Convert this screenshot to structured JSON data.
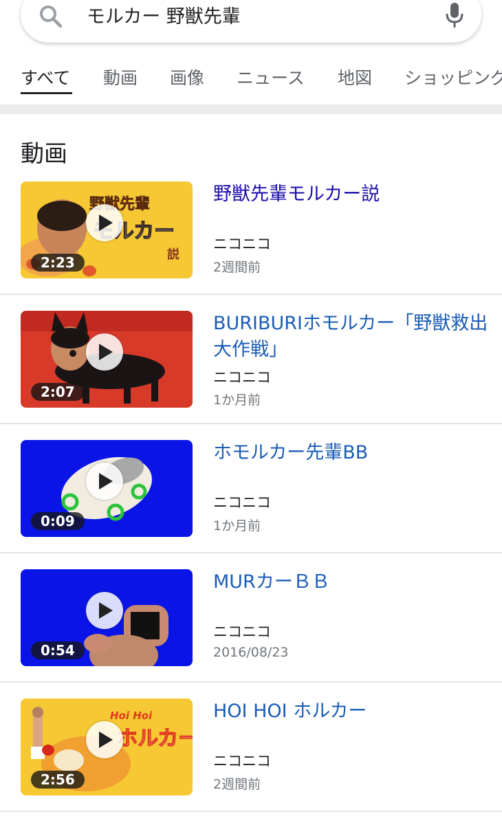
{
  "search": {
    "query": "モルカー 野獣先輩"
  },
  "tabs": [
    {
      "label": "すべて",
      "active": true
    },
    {
      "label": "動画"
    },
    {
      "label": "画像"
    },
    {
      "label": "ニュース"
    },
    {
      "label": "地図"
    },
    {
      "label": "ショッピング"
    }
  ],
  "section": {
    "title": "動画"
  },
  "videos": [
    {
      "title": "野獣先輩モルカー説",
      "source": "ニコニコ",
      "date": "2週間前",
      "duration": "2:23",
      "visited": true
    },
    {
      "title": "BURIBURIホモルカー「野獣救出大作戦」",
      "source": "ニコニコ",
      "date": "1か月前",
      "duration": "2:07"
    },
    {
      "title": "ホモルカー先輩BB",
      "source": "ニコニコ",
      "date": "1か月前",
      "duration": "0:09"
    },
    {
      "title": "MURカーＢＢ",
      "source": "ニコニコ",
      "date": "2016/08/23",
      "duration": "0:54"
    },
    {
      "title": "HOI HOI ホルカー",
      "source": "ニコニコ",
      "date": "2週間前",
      "duration": "2:56"
    }
  ],
  "thumb_text": {
    "t1_line1": "野獣先輩",
    "t1_line2": "モルカー",
    "t1_line3": "説",
    "t5_small": "Hoi Hoi",
    "t5_big": "ホルカー"
  },
  "colors": {
    "visited_link": "#1a0dab",
    "link": "#1a5cb5",
    "thumb_yellow": "#f6c833",
    "thumb_red": "#d83a2a",
    "thumb_blue": "#0a14e6"
  }
}
